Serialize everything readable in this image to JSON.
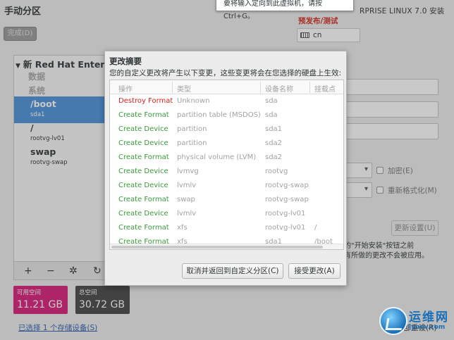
{
  "header": {
    "title": "手动分区",
    "done_label": "完成(D)",
    "product": "RPRISE LINUX 7.0 安装",
    "prerelease": "预发布/测试",
    "keyboard": "cn",
    "vm_tip": "要将输入定向到此虚拟机，请按 Ctrl+G。"
  },
  "left_panel": {
    "system_header": "新 Red Hat Enterpr",
    "group_data": "数据",
    "group_system": "系统",
    "mounts": [
      {
        "mount": "/boot",
        "device": "sda1"
      },
      {
        "mount": "/",
        "device": "rootvg-lv01"
      },
      {
        "mount": "swap",
        "device": "rootvg-swap"
      }
    ],
    "toolbar": {
      "add": "+",
      "remove": "−",
      "configure": "✲",
      "refresh": "↻"
    }
  },
  "storage": {
    "available_label": "可用空间",
    "available_value": "11.21 GB",
    "total_label": "总空间",
    "total_value": "30.72 GB",
    "selected_link": "已选择 1 个存储设备(S)",
    "full_reset": "全部重设(R)"
  },
  "right_panel": {
    "encrypt_label": "加密(E)",
    "reformat_label": "重新格式化(M)",
    "update_settings": "更新设置(U)",
    "note_line1": "的\"开始安装\"按钮之前",
    "note_line2": "有所做的更改不会被应用。"
  },
  "dialog": {
    "title": "更改摘要",
    "description": "您的自定义更改将产生以下变更，这些变更将会在您选择的硬盘上生效:",
    "columns": [
      "操作",
      "类型",
      "设备名称",
      "挂载点"
    ],
    "rows": [
      {
        "action": "Destroy Format",
        "type": "Unknown",
        "device": "sda",
        "mount": ""
      },
      {
        "action": "Create Format",
        "type": "partition table (MSDOS)",
        "device": "sda",
        "mount": ""
      },
      {
        "action": "Create Device",
        "type": "partition",
        "device": "sda1",
        "mount": ""
      },
      {
        "action": "Create Device",
        "type": "partition",
        "device": "sda2",
        "mount": ""
      },
      {
        "action": "Create Format",
        "type": "physical volume (LVM)",
        "device": "sda2",
        "mount": ""
      },
      {
        "action": "Create Device",
        "type": "lvmvg",
        "device": "rootvg",
        "mount": ""
      },
      {
        "action": "Create Device",
        "type": "lvmlv",
        "device": "rootvg-swap",
        "mount": ""
      },
      {
        "action": "Create Format",
        "type": "swap",
        "device": "rootvg-swap",
        "mount": ""
      },
      {
        "action": "Create Device",
        "type": "lvmlv",
        "device": "rootvg-lv01",
        "mount": ""
      },
      {
        "action": "Create Format",
        "type": "xfs",
        "device": "rootvg-lv01",
        "mount": "/"
      },
      {
        "action": "Create Format",
        "type": "xfs",
        "device": "sda1",
        "mount": "/boot"
      }
    ],
    "cancel_label": "取消并返回到自定义分区(C)",
    "accept_label": "接受更改(A)"
  },
  "watermark": {
    "cn": "运维网",
    "en": "iyunv.com"
  },
  "colors": {
    "destroy": "#d9251d",
    "create": "#3a9a3a",
    "selected": "#4a90d9",
    "available": "#d81b7a",
    "total": "#454545"
  }
}
